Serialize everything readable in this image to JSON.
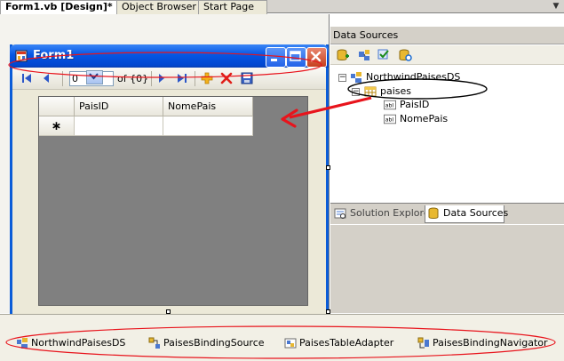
{
  "doc_tabs": {
    "form1": "Form1.vb [Design]*",
    "object_browser": "Object Browser",
    "start_page": "Start Page"
  },
  "form": {
    "title": "Form1",
    "navigator": {
      "position_value": "0",
      "count_text": "of {0}"
    },
    "grid": {
      "columns": [
        "PaisID",
        "NomePais"
      ],
      "new_row_marker": "∗"
    }
  },
  "data_sources": {
    "title": "Data Sources",
    "tree": {
      "dataset": "NorthwindPaisesDS",
      "table": "paises",
      "fields": [
        "PaisID",
        "NomePais"
      ],
      "field_icon_text": "abl"
    },
    "tabs": {
      "solution_explorer": "Solution Explorer",
      "data_sources": "Data Sources"
    }
  },
  "component_tray": {
    "items": [
      "NorthwindPaisesDS",
      "PaisesBindingSource",
      "PaisesTableAdapter",
      "PaisesBindingNavigator"
    ]
  },
  "colors": {
    "annotation_red": "#e8141c",
    "annotation_black": "#000000",
    "titlebar_blue": "#0556e4"
  }
}
